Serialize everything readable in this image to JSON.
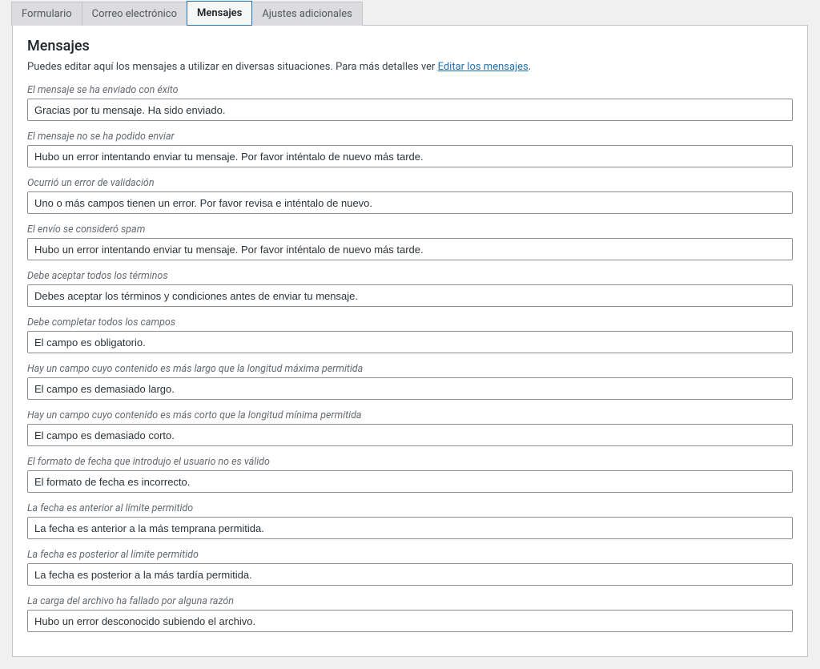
{
  "tabs": {
    "form": "Formulario",
    "mail": "Correo electrónico",
    "messages": "Mensajes",
    "additional": "Ajustes adicionales"
  },
  "panel": {
    "title": "Mensajes",
    "description_pre": "Puedes editar aquí los mensajes a utilizar en diversas situaciones. Para más detalles ver ",
    "description_link": "Editar los mensajes",
    "description_post": "."
  },
  "messages": [
    {
      "label": "El mensaje se ha enviado con éxito",
      "value": "Gracias por tu mensaje. Ha sido enviado."
    },
    {
      "label": "El mensaje no se ha podido enviar",
      "value": "Hubo un error intentando enviar tu mensaje. Por favor inténtalo de nuevo más tarde."
    },
    {
      "label": "Ocurrió un error de validación",
      "value": "Uno o más campos tienen un error. Por favor revisa e inténtalo de nuevo."
    },
    {
      "label": "El envío se consideró spam",
      "value": "Hubo un error intentando enviar tu mensaje. Por favor inténtalo de nuevo más tarde."
    },
    {
      "label": "Debe aceptar todos los términos",
      "value": "Debes aceptar los términos y condiciones antes de enviar tu mensaje."
    },
    {
      "label": "Debe completar todos los campos",
      "value": "El campo es obligatorio."
    },
    {
      "label": "Hay un campo cuyo contenido es más largo que la longitud máxima permitida",
      "value": "El campo es demasiado largo."
    },
    {
      "label": "Hay un campo cuyo contenido es más corto que la longitud mínima permitida",
      "value": "El campo es demasiado corto."
    },
    {
      "label": "El formato de fecha que introdujo el usuario no es válido",
      "value": "El formato de fecha es incorrecto."
    },
    {
      "label": "La fecha es anterior al límite permitido",
      "value": "La fecha es anterior a la más temprana permitida."
    },
    {
      "label": "La fecha es posterior al límite permitido",
      "value": "La fecha es posterior a la más tardía permitida."
    },
    {
      "label": "La carga del archivo ha fallado por alguna razón",
      "value": "Hubo un error desconocido subiendo el archivo."
    }
  ]
}
